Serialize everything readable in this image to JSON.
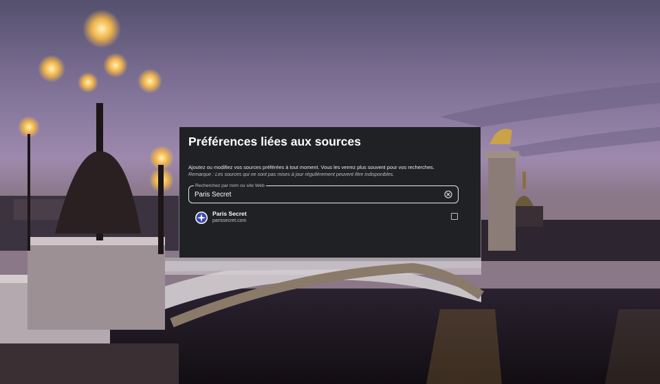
{
  "dialog": {
    "title": "Préférences liées aux sources",
    "description": "Ajoutez ou modifiez vos sources préférées à tout moment. Vous les verrez plus souvent pour vos recherches.",
    "note": "Remarque : Les sources qui ne sont pas mises à jour régulièrement peuvent être indisponibles."
  },
  "search": {
    "label": "Recherchez par nom ou site Web",
    "value": "Paris Secret",
    "clear_icon": "clear-circle-icon"
  },
  "results": [
    {
      "name": "Paris Secret",
      "url": "parissecret.com",
      "icon": "paris-secret-favicon",
      "checked": false
    }
  ],
  "colors": {
    "dialog_bg": "#202124",
    "text_primary": "#ffffff",
    "text_secondary": "#bdc1c6"
  }
}
